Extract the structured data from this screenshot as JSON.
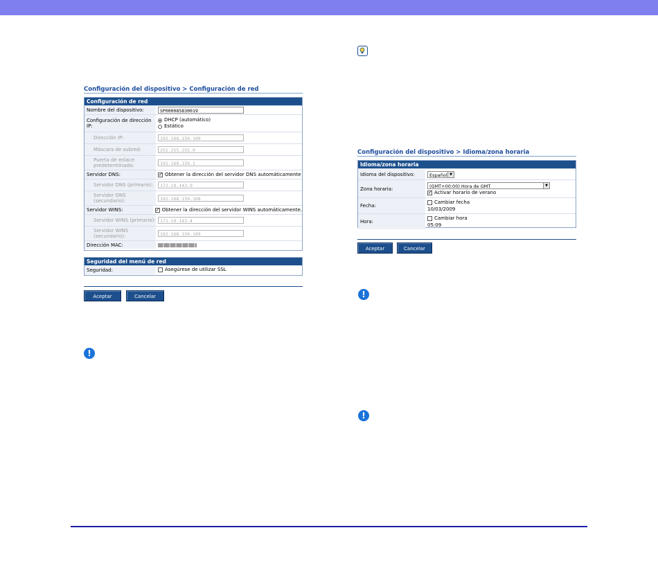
{
  "network": {
    "breadcrumb": "Configuración del dispositivo > Configuración de red",
    "header": "Configuración de red",
    "device_name_label": "Nombre del dispositivo:",
    "device_name_value": "SP000085830019",
    "ip_config_label": "Configuración de dirección IP:",
    "dhcp_label": "DHCP (automático)",
    "static_label": "Estático",
    "ip_label": "Dirección IP:",
    "ip_value": "192.168.159.100",
    "mask_label": "Máscara de subred:",
    "mask_value": "255.255.255.0",
    "gateway_label": "Puerta de enlace predeterminada:",
    "gateway_value": "192.168.159.1",
    "dns_label": "Servidor DNS:",
    "dns_auto_label": "Obtener la dirección del servidor DNS automáticamente",
    "dns_primary_label": "Servidor DNS (primario):",
    "dns_primary_value": "172.19.143.9",
    "dns_secondary_label": "Servidor DNS (secundario):",
    "dns_secondary_value": "192.168.150.108",
    "wins_label": "Servidor WINS:",
    "wins_auto_label": "Obtener la dirección del servidor WINS automáticamente.",
    "wins_primary_label": "Servidor WINS (primario):",
    "wins_primary_value": "172.19.143.4",
    "wins_secondary_label": "Servidor WINS (secundario):",
    "wins_secondary_value": "192.168.150.109",
    "mac_label": "Dirección MAC:",
    "security_header": "Seguridad del menú de red",
    "security_label": "Seguridad:",
    "ssl_label": "Asegúrese de utilizar SSL",
    "accept": "Aceptar",
    "cancel": "Cancelar"
  },
  "timezone": {
    "breadcrumb": "Configuración del dispositivo > Idioma/zona horaria",
    "header": "Idioma/zona horaria",
    "language_label": "Idioma del dispositivo:",
    "language_value": "Español",
    "zone_label": "Zona horaria:",
    "zone_value": "(GMT+00:00) Hora de GMT",
    "dst_label": "Activar horario de verano",
    "date_label": "Fecha:",
    "change_date_label": "Cambiar fecha",
    "date_value": "10/03/2009",
    "time_label": "Hora:",
    "change_time_label": "Cambiar hora",
    "time_value": "05:09",
    "accept": "Aceptar",
    "cancel": "Cancelar"
  },
  "icons": [
    "hint-icon",
    "important-icon",
    "important-icon",
    "important-icon"
  ],
  "colors": {
    "header_bar": "#7f7ff0",
    "panel_header": "#1c4f8c",
    "breadcrumb": "#1e4c9e",
    "important_icon": "#1a73d9"
  }
}
